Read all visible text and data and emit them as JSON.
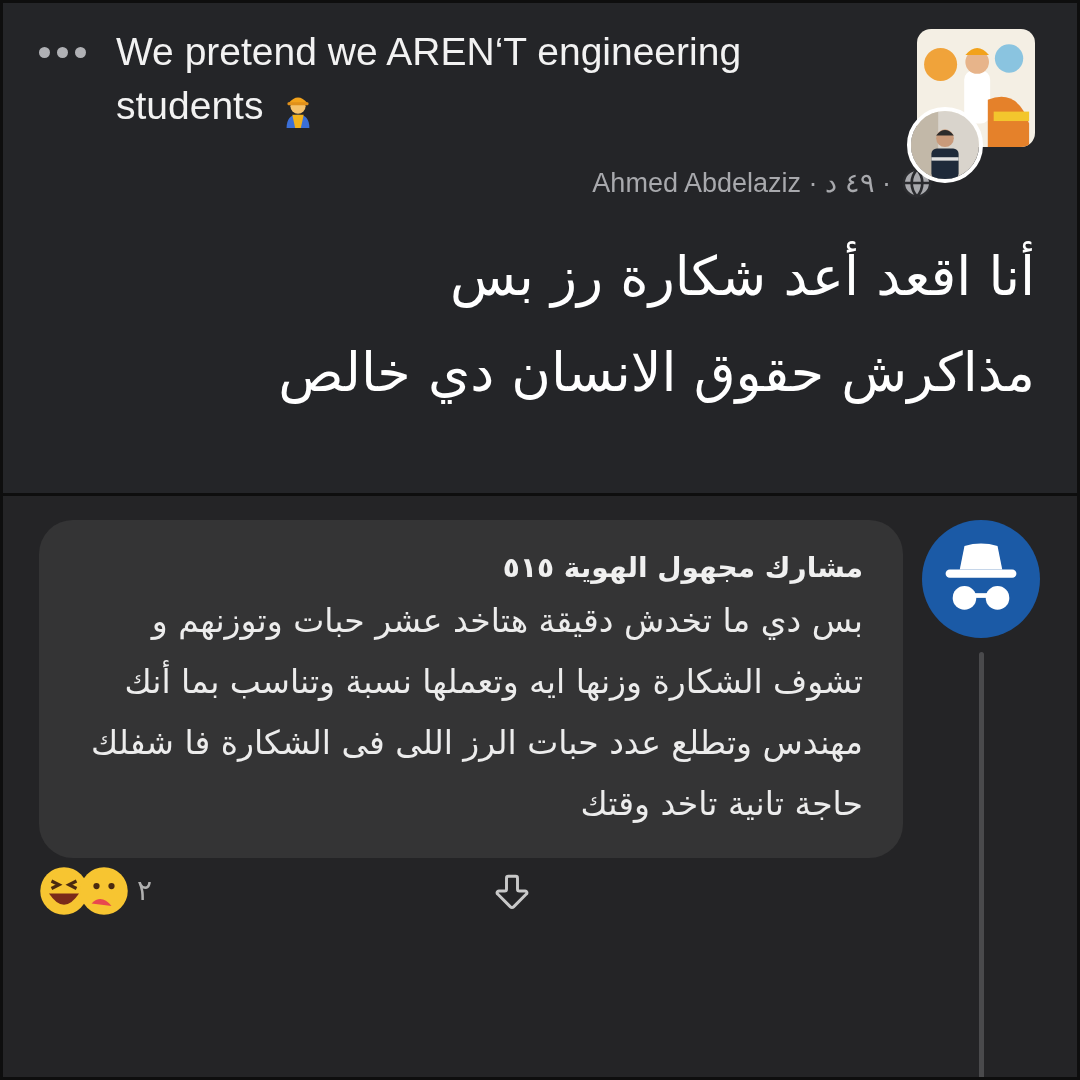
{
  "post": {
    "title": "We pretend we AREN‘T engineering students",
    "meta": "Ahmed Abdelaziz · ٤٩ د ·",
    "body": [
      "أنا اقعد أعد شكارة رز بس",
      "مذاكرش حقوق الانسان دي خالص"
    ]
  },
  "comment": {
    "author": "مشارك مجهول الهوية ٥١٥",
    "text": "بس دي ما تخدش دقيقة هتاخد عشر حبات وتوزنهم و تشوف الشكارة وزنها ايه وتعملها نسبة وتناسب بما أنك مهندس وتطلع عدد حبات الرز اللى فى الشكارة فا شفلك حاجة تانية تاخد وقتك",
    "reaction_count": "٢"
  }
}
